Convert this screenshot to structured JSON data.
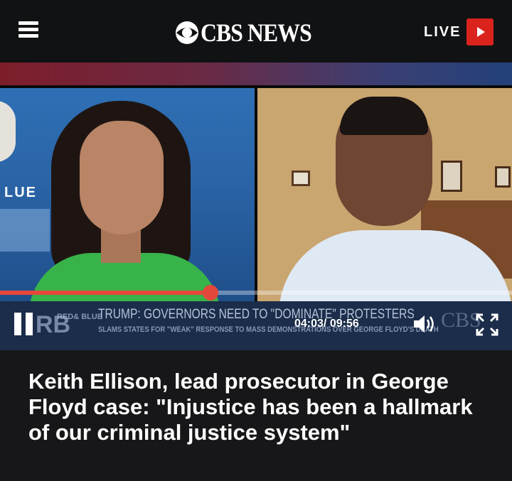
{
  "header": {
    "logo_text": "CBS NEWS",
    "live_label": "LIVE",
    "accent_color": "#d9231c"
  },
  "player": {
    "progress_fraction": 0.4112,
    "current_time": "04:03",
    "duration": "09:56",
    "time_display": "04:03/ 09:56",
    "progress_color": "#e4473b",
    "chyron": {
      "brand_short": "RB",
      "brand_lines": "RED& BLUE",
      "headline": "TRUMP: GOVERNORS NEED TO \"DOMINATE\" PROTESTERS",
      "subline": "SLAMS STATES FOR \"WEAK\" RESPONSE TO MASS DEMONSTRATIONS OVER GEORGE FLOYD'S DEATH",
      "network_mark": "CBS"
    },
    "set_text": "LUE",
    "icons": {
      "pause": "pause-icon",
      "volume": "volume-icon",
      "fullscreen": "fullscreen-icon"
    }
  },
  "article": {
    "title": "Keith Ellison, lead prosecutor in George Floyd case: \"Injustice has been a hallmark of our criminal justice system\""
  }
}
